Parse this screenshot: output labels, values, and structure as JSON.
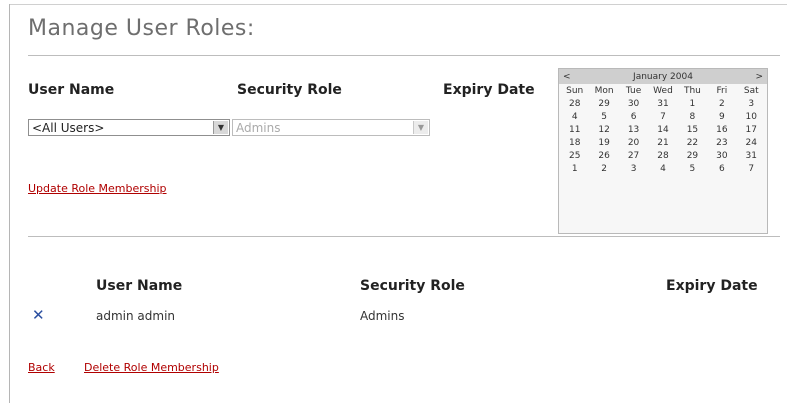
{
  "page": {
    "title": "Manage User Roles:"
  },
  "form": {
    "user_name_label": "User Name",
    "security_role_label": "Security Role",
    "expiry_date_label": "Expiry Date",
    "user_select_value": "<All Users>",
    "role_select_value": "Admins",
    "update_link": "Update Role Membership"
  },
  "calendar": {
    "prev": "<",
    "month_label": "January 2004",
    "next": ">",
    "weekdays": [
      "Sun",
      "Mon",
      "Tue",
      "Wed",
      "Thu",
      "Fri",
      "Sat"
    ],
    "days": [
      [
        "28",
        "29",
        "30",
        "31",
        "1",
        "2",
        "3"
      ],
      [
        "4",
        "5",
        "6",
        "7",
        "8",
        "9",
        "10"
      ],
      [
        "11",
        "12",
        "13",
        "14",
        "15",
        "16",
        "17"
      ],
      [
        "18",
        "19",
        "20",
        "21",
        "22",
        "23",
        "24"
      ],
      [
        "25",
        "26",
        "27",
        "28",
        "29",
        "30",
        "31"
      ],
      [
        "1",
        "2",
        "3",
        "4",
        "5",
        "6",
        "7"
      ]
    ]
  },
  "table": {
    "headers": {
      "user_name": "User Name",
      "security_role": "Security Role",
      "expiry_date": "Expiry Date"
    },
    "rows": [
      {
        "delete_icon": "x-icon",
        "user_name": "admin admin",
        "security_role": "Admins",
        "expiry_date": ""
      }
    ]
  },
  "footer": {
    "back_link": "Back",
    "delete_link": "Delete Role Membership"
  },
  "colors": {
    "link": "#b00000",
    "delete_icon": "#2b4fa0",
    "title": "#6e6e6e"
  }
}
